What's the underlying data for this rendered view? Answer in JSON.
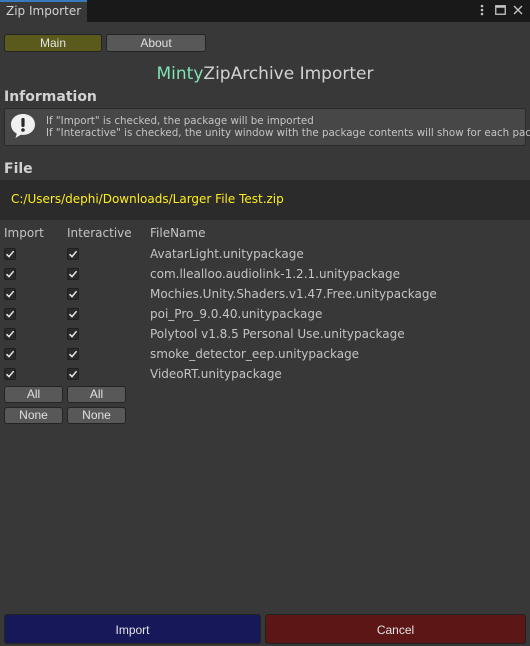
{
  "window": {
    "tab_title": "Zip Importer"
  },
  "toolbar": {
    "main_label": "Main",
    "about_label": "About"
  },
  "header": {
    "title_accent": "Minty",
    "title_rest": "ZipArchive Importer"
  },
  "information": {
    "heading": "Information",
    "line1": "If \"Import\" is checked, the package will be imported",
    "line2": "If \"Interactive\" is checked, the unity window with the package contents will show for each package"
  },
  "file": {
    "heading": "File",
    "path": "C:/Users/dephi/Downloads/Larger File Test.zip"
  },
  "table": {
    "headers": {
      "import": "Import",
      "interactive": "Interactive",
      "filename": "FileName"
    },
    "rows": [
      {
        "file": "AvatarLight.unitypackage",
        "import": true,
        "interactive": true
      },
      {
        "file": "com.llealloo.audiolink-1.2.1.unitypackage",
        "import": true,
        "interactive": true
      },
      {
        "file": "Mochies.Unity.Shaders.v1.47.Free.unitypackage",
        "import": true,
        "interactive": true
      },
      {
        "file": "poi_Pro_9.0.40.unitypackage",
        "import": true,
        "interactive": true
      },
      {
        "file": "Polytool v1.8.5 Personal Use.unitypackage",
        "import": true,
        "interactive": true
      },
      {
        "file": "smoke_detector_eep.unitypackage",
        "import": true,
        "interactive": true
      },
      {
        "file": "VideoRT.unitypackage",
        "import": true,
        "interactive": true
      }
    ]
  },
  "selection_buttons": {
    "import_all": "All",
    "interactive_all": "All",
    "import_none": "None",
    "interactive_none": "None"
  },
  "footer": {
    "import_label": "Import",
    "cancel_label": "Cancel"
  },
  "colors": {
    "import_button": "#171859",
    "cancel_button": "#5c1616",
    "path_text": "#ffef18",
    "title_accent": "#7fe3b5",
    "main_tab": "#5a5a1c"
  }
}
